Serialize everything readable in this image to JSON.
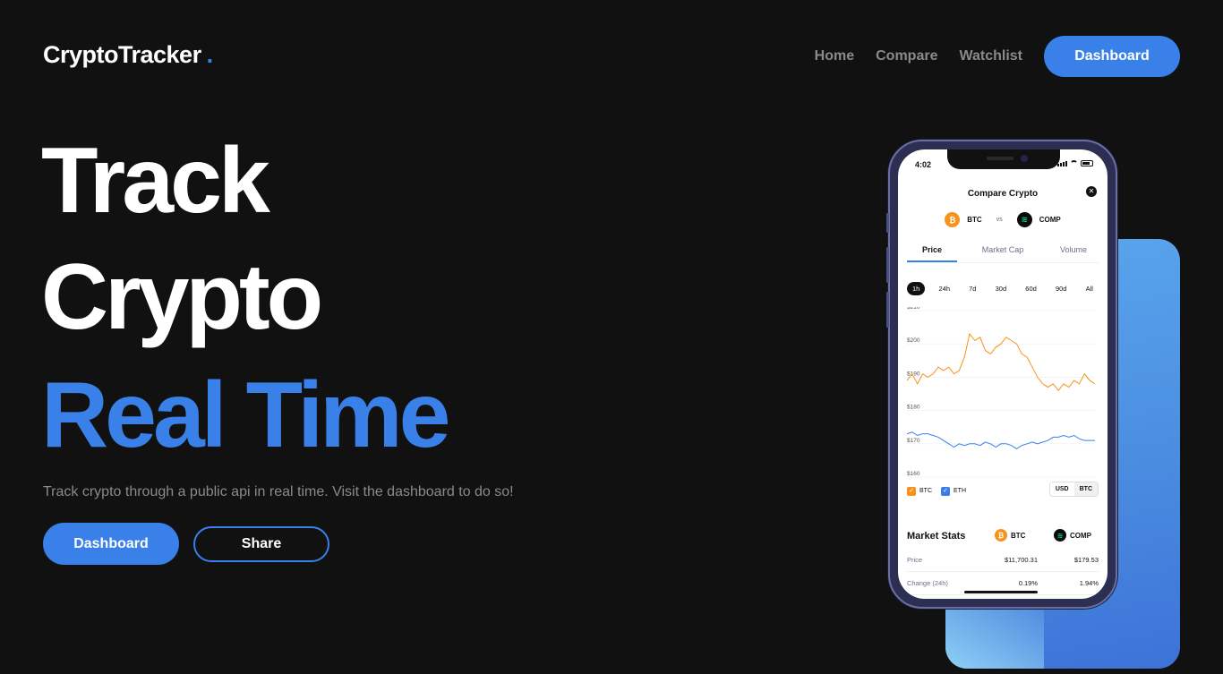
{
  "header": {
    "logo": "CryptoTracker",
    "logo_dot": ".",
    "nav": [
      "Home",
      "Compare",
      "Watchlist"
    ],
    "cta": "Dashboard"
  },
  "hero": {
    "line1": "Track",
    "line2": "Crypto",
    "line3": "Real Time",
    "subtitle": "Track crypto through a public api in real time. Visit the dashboard to do so!",
    "primary_btn": "Dashboard",
    "secondary_btn": "Share"
  },
  "colors": {
    "accent": "#3a80e9",
    "background": "#111112",
    "muted": "#8a8a8e",
    "btc": "#f7931a",
    "eth": "#3a80e9"
  },
  "phone": {
    "time": "4:02",
    "title": "Compare Crypto",
    "close_icon": "close-icon",
    "coin_a": {
      "symbol": "BTC",
      "icon": "bitcoin-icon"
    },
    "vs": "vs",
    "coin_b": {
      "symbol": "COMP",
      "icon": "compound-icon"
    },
    "tabs": [
      "Price",
      "Market Cap",
      "Volume"
    ],
    "active_tab": "Price",
    "ranges": [
      "1h",
      "24h",
      "7d",
      "30d",
      "60d",
      "90d",
      "All"
    ],
    "active_range": "1h",
    "legend": [
      "BTC",
      "ETH"
    ],
    "currency": [
      "USD",
      "BTC"
    ],
    "market_stats": {
      "title": "Market Stats",
      "col_a": "BTC",
      "col_b": "COMP",
      "rows": [
        {
          "label": "Price",
          "a": "$11,700.31",
          "b": "$179.53"
        },
        {
          "label": "Change (24h)",
          "a": "0.19%",
          "b": "1.94%"
        }
      ]
    }
  },
  "chart_data": {
    "type": "line",
    "ylabels": [
      "$210",
      "$200",
      "$190",
      "$180",
      "$170",
      "$160"
    ],
    "ylim": [
      160,
      210
    ],
    "series": [
      {
        "name": "BTC",
        "color": "#f7931a",
        "values": [
          189,
          191,
          188,
          191,
          190,
          191,
          193,
          192,
          193,
          191,
          192,
          196,
          203,
          201,
          202,
          198,
          197,
          199,
          200,
          202,
          201,
          200,
          197,
          196,
          193,
          190,
          188,
          187,
          188,
          186,
          188,
          187,
          189,
          188,
          191,
          189,
          188
        ]
      },
      {
        "name": "ETH",
        "color": "#3a80e9",
        "values": [
          173,
          173.5,
          172.5,
          173,
          173,
          172.5,
          172,
          171,
          170,
          169,
          170,
          169.5,
          170,
          170,
          169.5,
          170.5,
          170,
          169,
          170,
          170,
          169.5,
          168.5,
          169.5,
          170,
          170.5,
          170,
          170.5,
          171,
          172,
          172,
          172.5,
          172,
          172.5,
          171.5,
          171,
          171,
          171
        ]
      }
    ]
  }
}
